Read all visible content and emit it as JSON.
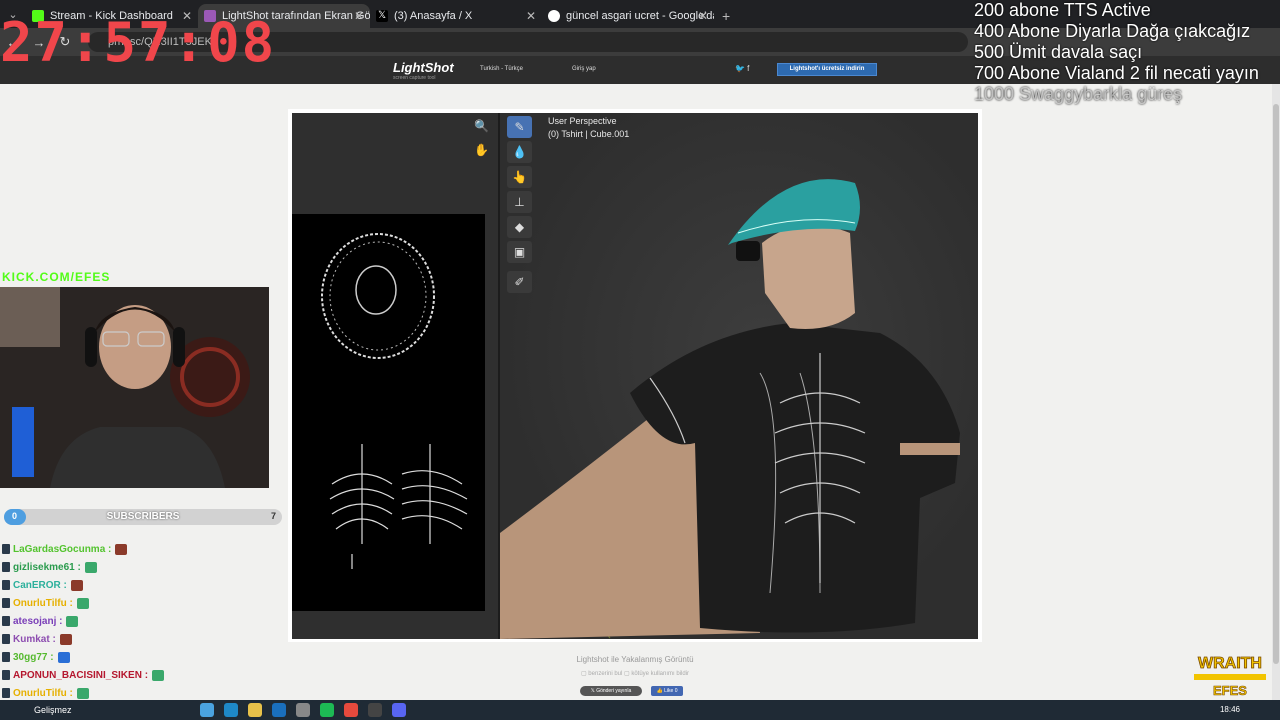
{
  "browser": {
    "tabs": [
      {
        "label": "Stream - Kick Dashboard",
        "color": "#53fc18"
      },
      {
        "label": "LightShot tarafından Ekran Gör",
        "color": "#9b59b6"
      },
      {
        "label": "(3) Anasayfa / X",
        "color": "#000000"
      },
      {
        "label": "güncel asgari ucret - Google'da",
        "color": "#4285f4"
      }
    ],
    "url": "prnt.sc/QR3II1T5JEK"
  },
  "lightshot": {
    "logo": "LightShot",
    "tagline": "screen capture tool",
    "language": "Turkish - Türkçe",
    "login": "Giriş yap",
    "social": "🐦  f",
    "download_button": "Lightshot'ı ücretsiz indirin",
    "caption": "Lightshot ile Yakalanmış Görüntü",
    "sub_links": "▢ benzerini bul   ▢ kötüye kullanımı bildir",
    "share_button": "𝕏 Gönderi yayınla",
    "like_button": "👍 Like 0"
  },
  "blender": {
    "perspective": "User Perspective",
    "object": "(0) Tshirt | Cube.001",
    "tools": [
      "brush-icon",
      "drop-icon",
      "smear-icon",
      "stamp-icon",
      "fill-icon",
      "mask-icon",
      "annotate-icon"
    ]
  },
  "stream_overlay": {
    "goals": [
      "200 abone TTS Active",
      "400 Abone Diyarla Dağa çıakcağız",
      "500 Ümit davala saçı",
      "700 Abone Vialand 2 fil necati yayın",
      "1000 Swaggybarkla güreş"
    ],
    "timer": "27:57:08",
    "kick_link": "KICK.COM/EFES",
    "subscribers": {
      "label": "SUBSCRIBERS",
      "min": "0",
      "max": "7",
      "progress": 0.0
    }
  },
  "chat": [
    {
      "user": "LaGardasGocunma :",
      "color": "#53c32e"
    },
    {
      "user": "gizlisekme61 :",
      "color": "#2a9b4d"
    },
    {
      "user": "CanEROR :",
      "color": "#2bb09b"
    },
    {
      "user": "OnurluTilfu :",
      "color": "#e6b000"
    },
    {
      "user": "atesojanj :",
      "color": "#7a3fb8"
    },
    {
      "user": "Kumkat :",
      "color": "#8d4db0"
    },
    {
      "user": "30gg77 :",
      "color": "#55b92e"
    },
    {
      "user": "APONUN_BACISINI_SIKEN :",
      "color": "#b5172e"
    },
    {
      "user": "OnurluTilfu :",
      "color": "#e6b000"
    }
  ],
  "watermark": {
    "top": "WRAITH",
    "bottom": "EFES"
  },
  "taskbar": {
    "weather": "Gelişmez",
    "time": "18:46"
  }
}
